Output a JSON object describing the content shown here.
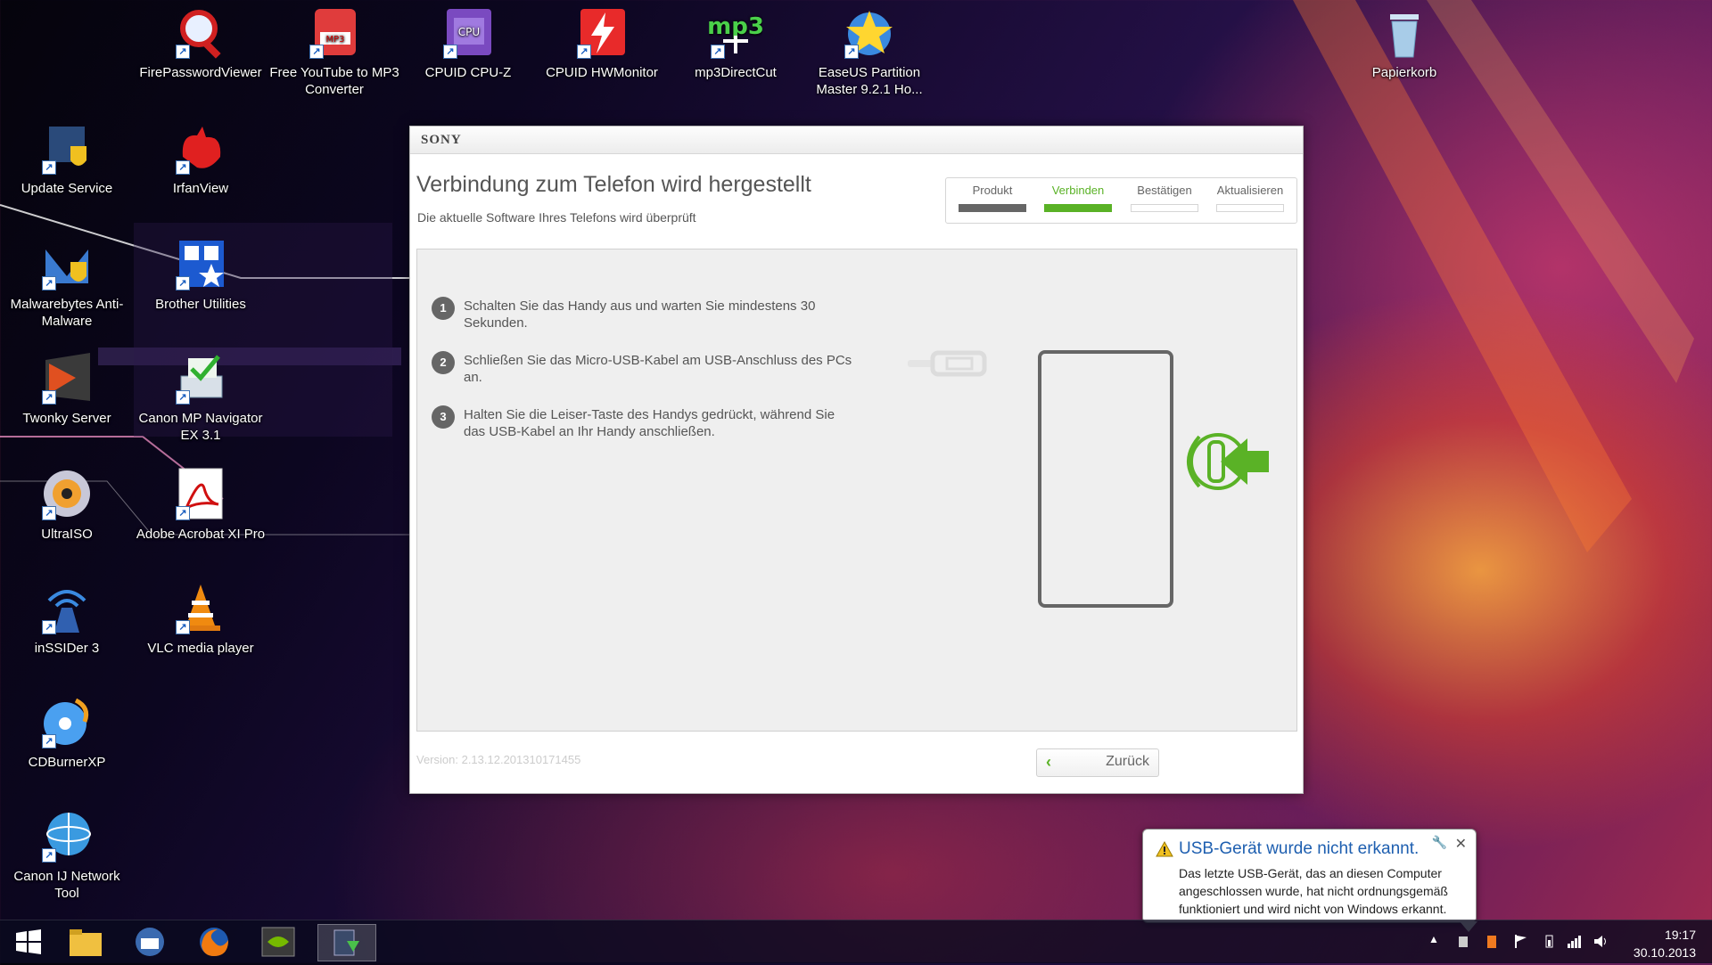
{
  "desktop": {
    "icons": [
      {
        "label": "FirePasswordViewer",
        "icon": "key-magnifier-icon"
      },
      {
        "label": "Free YouTube to MP3 Converter",
        "icon": "mp3-file-icon"
      },
      {
        "label": "CPUID CPU-Z",
        "icon": "cpu-chip-icon"
      },
      {
        "label": "CPUID HWMonitor",
        "icon": "lightning-monitor-icon"
      },
      {
        "label": "mp3DirectCut",
        "icon": "mp3-cut-icon"
      },
      {
        "label": "EaseUS Partition Master 9.2.1 Ho...",
        "icon": "partition-star-icon"
      },
      {
        "label": "Papierkorb",
        "icon": "recycle-bin-icon"
      },
      {
        "label": "Update Service",
        "icon": "update-shield-icon"
      },
      {
        "label": "IrfanView",
        "icon": "red-cat-icon"
      },
      {
        "label": "Malwarebytes Anti-Malware",
        "icon": "malwarebytes-icon"
      },
      {
        "label": "Brother Utilities",
        "icon": "toolbox-icon"
      },
      {
        "label": "Twonky Server",
        "icon": "twonky-icon"
      },
      {
        "label": "Canon MP Navigator EX 3.1",
        "icon": "scanner-icon"
      },
      {
        "label": "UltraISO",
        "icon": "disc-icon"
      },
      {
        "label": "Adobe Acrobat XI Pro",
        "icon": "pdf-icon"
      },
      {
        "label": "inSSIDer 3",
        "icon": "wifi-tower-icon"
      },
      {
        "label": "VLC media player",
        "icon": "vlc-cone-icon"
      },
      {
        "label": "CDBurnerXP",
        "icon": "cd-burner-icon"
      },
      {
        "label": "Canon IJ Network Tool",
        "icon": "network-globe-icon"
      }
    ]
  },
  "dialog": {
    "brand": "SONY",
    "title": "Verbindung zum Telefon wird hergestellt",
    "subtitle": "Die aktuelle Software Ihres Telefons wird überprüft",
    "steps": [
      {
        "label": "Produkt",
        "state": "done"
      },
      {
        "label": "Verbinden",
        "state": "active"
      },
      {
        "label": "Bestätigen",
        "state": "pending"
      },
      {
        "label": "Aktualisieren",
        "state": "pending"
      }
    ],
    "instructions": [
      {
        "num": "1",
        "text": "Schalten Sie das Handy aus und warten Sie mindestens 30 Sekunden."
      },
      {
        "num": "2",
        "text": "Schließen Sie das Micro-USB-Kabel am USB-Anschluss des PCs an."
      },
      {
        "num": "3",
        "text": "Halten Sie die Leiser-Taste des Handys gedrückt, während Sie das USB-Kabel an Ihr Handy anschließen."
      }
    ],
    "version": "Version: 2.13.12.201310171455",
    "back_label": "Zurück"
  },
  "notification": {
    "title": "USB-Gerät wurde nicht erkannt.",
    "body": "Das letzte USB-Gerät, das an diesen Computer angeschlossen wurde, hat nicht ordnungsgemäß funktioniert und wird nicht von Windows erkannt."
  },
  "taskbar": {
    "time": "19:17",
    "date": "30.10.2013"
  },
  "colors": {
    "accent_green": "#5ab226",
    "inactive_bar": "#666666",
    "notification_title": "#1e5fb0"
  }
}
